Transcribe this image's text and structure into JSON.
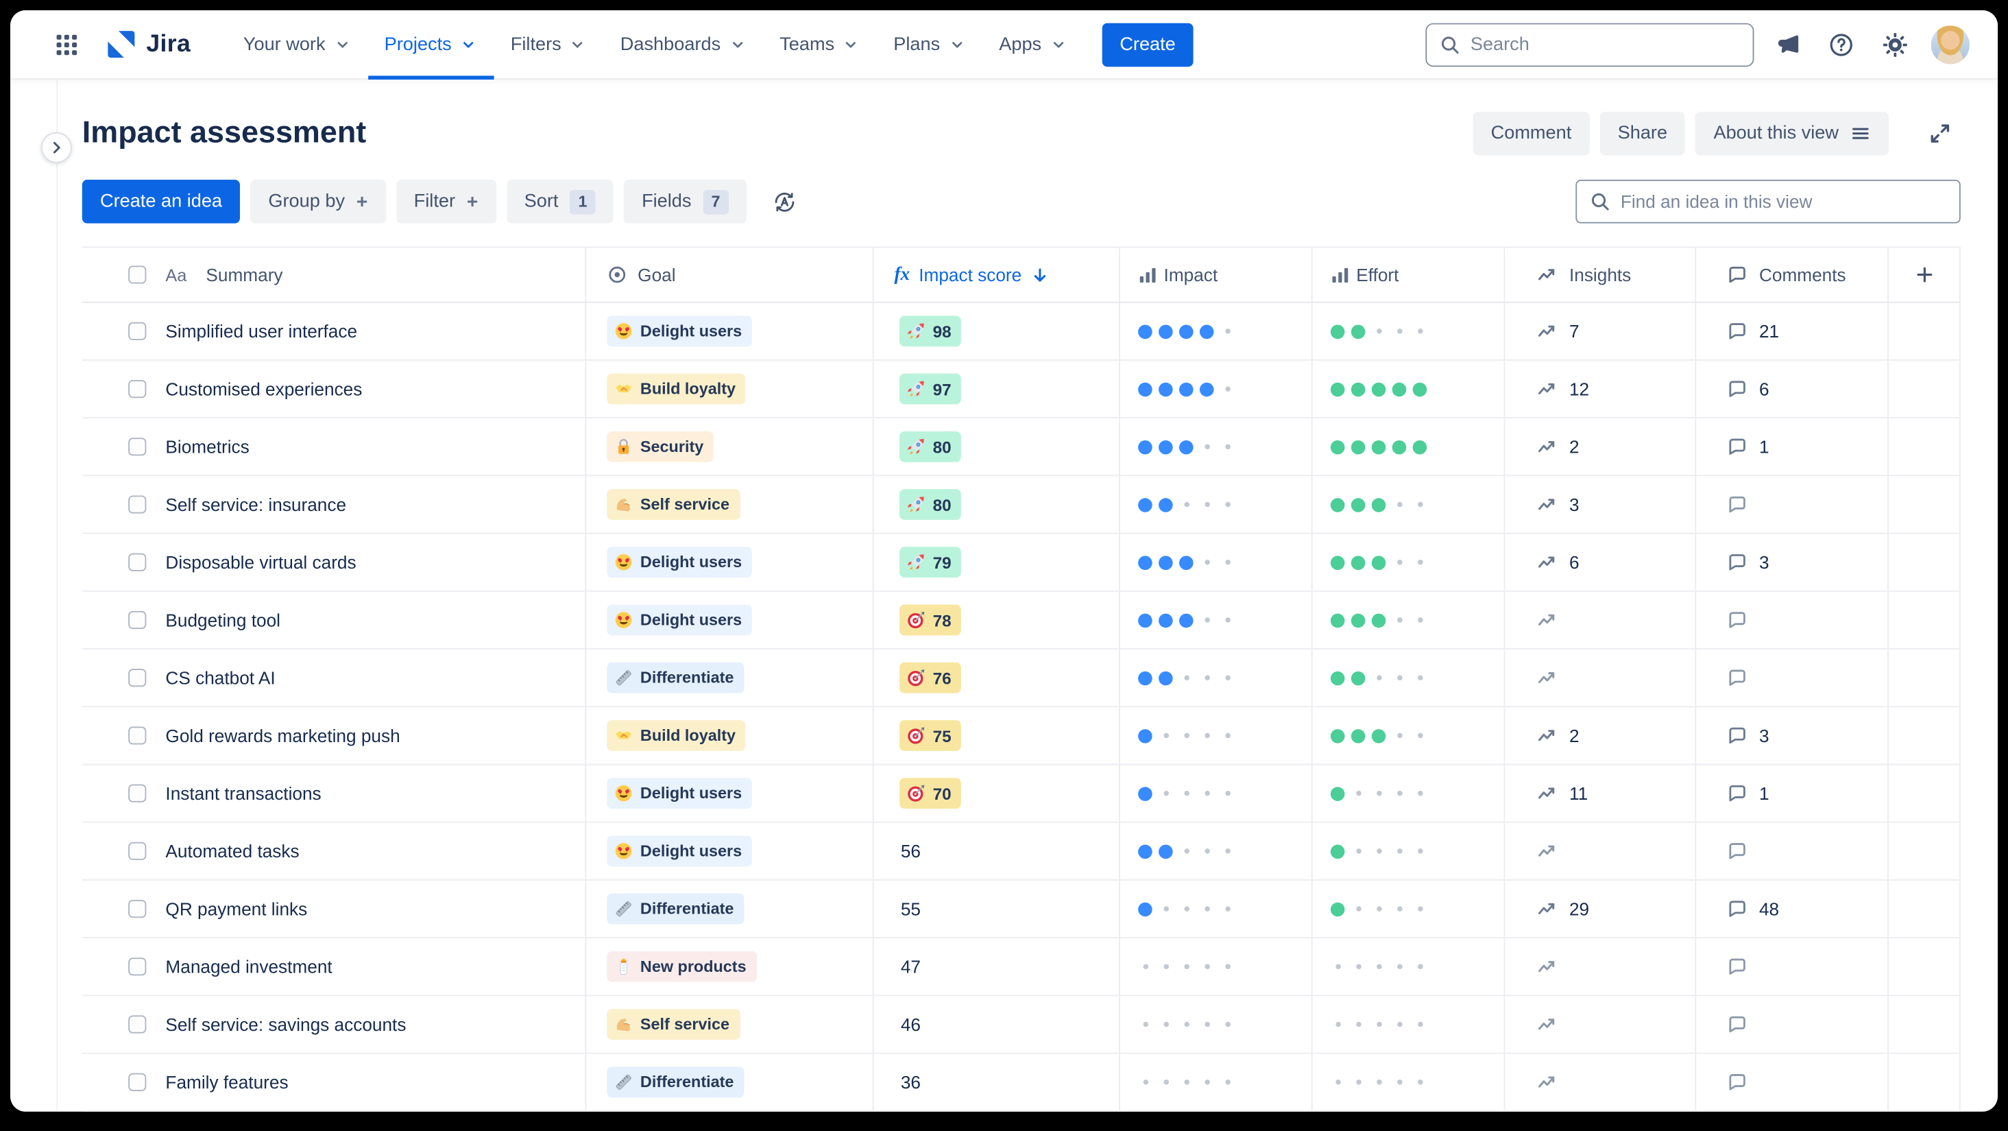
{
  "nav": {
    "app_name": "Jira",
    "items": [
      "Your work",
      "Projects",
      "Filters",
      "Dashboards",
      "Teams",
      "Plans",
      "Apps"
    ],
    "active_item": "Projects",
    "create_label": "Create",
    "search_placeholder": "Search"
  },
  "header": {
    "title": "Impact assessment",
    "comment_label": "Comment",
    "share_label": "Share",
    "about_label": "About this view"
  },
  "toolbar": {
    "create_idea_label": "Create an idea",
    "group_by_label": "Group by",
    "filter_label": "Filter",
    "sort_label": "Sort",
    "sort_count": "1",
    "fields_label": "Fields",
    "fields_count": "7",
    "find_placeholder": "Find an idea in this view"
  },
  "colors": {
    "accent_blue": "#0C66E4",
    "text_dark": "#172B4D",
    "text_subtle": "#44546F",
    "border": "#EBECF0"
  },
  "table": {
    "columns": [
      {
        "key": "summary",
        "label": "Summary",
        "icon": "text-style-icon"
      },
      {
        "key": "goal",
        "label": "Goal",
        "icon": "goal-icon"
      },
      {
        "key": "score",
        "label": "Impact score",
        "icon": "fx-icon",
        "sorted": "desc",
        "color": "#0C66E4"
      },
      {
        "key": "impact",
        "label": "Impact",
        "icon": "bar-chart-icon"
      },
      {
        "key": "effort",
        "label": "Effort",
        "icon": "bar-chart-icon"
      },
      {
        "key": "insights",
        "label": "Insights",
        "icon": "trend-icon"
      },
      {
        "key": "comments",
        "label": "Comments",
        "icon": "comment-icon"
      },
      {
        "key": "add",
        "label": "",
        "icon": "plus-icon"
      }
    ],
    "goal_styles": {
      "Delight users": {
        "icon": "heart-eyes-emoji",
        "bg": "#E9F2FF"
      },
      "Build loyalty": {
        "icon": "handshake-emoji",
        "bg": "#FBF0CA"
      },
      "Security": {
        "icon": "locked-with-key-emoji",
        "bg": "#FDEFDC"
      },
      "Self service": {
        "icon": "flexed-biceps-emoji",
        "bg": "#FBF0CA"
      },
      "Differentiate": {
        "icon": "ruler-emoji",
        "bg": "#E4F0FC"
      },
      "New products": {
        "icon": "baby-bottle-emoji",
        "bg": "#FBECEC"
      }
    },
    "score_styles": {
      "green": {
        "icon": "rocket-emoji",
        "bg": "#BAF3DB"
      },
      "yellow": {
        "icon": "dart-emoji",
        "bg": "#F8E6A0"
      }
    },
    "dot_colors": {
      "impact": "#388BFF",
      "effort": "#4BCE97",
      "empty": "#C2C8D1"
    },
    "dots_max": 5,
    "rows": [
      {
        "summary": "Simplified user interface",
        "goal": "Delight users",
        "score": 98,
        "score_style": "green",
        "impact": 4,
        "effort": 2,
        "insights": 7,
        "comments": 21
      },
      {
        "summary": "Customised experiences",
        "goal": "Build loyalty",
        "score": 97,
        "score_style": "green",
        "impact": 4,
        "effort": 5,
        "insights": 12,
        "comments": 6
      },
      {
        "summary": "Biometrics",
        "goal": "Security",
        "score": 80,
        "score_style": "green",
        "impact": 3,
        "effort": 5,
        "insights": 2,
        "comments": 1
      },
      {
        "summary": "Self service: insurance",
        "goal": "Self service",
        "score": 80,
        "score_style": "green",
        "impact": 2,
        "effort": 3,
        "insights": 3,
        "comments": null
      },
      {
        "summary": "Disposable virtual cards",
        "goal": "Delight users",
        "score": 79,
        "score_style": "green",
        "impact": 3,
        "effort": 3,
        "insights": 6,
        "comments": 3
      },
      {
        "summary": "Budgeting tool",
        "goal": "Delight users",
        "score": 78,
        "score_style": "yellow",
        "impact": 3,
        "effort": 3,
        "insights": null,
        "comments": null
      },
      {
        "summary": "CS chatbot AI",
        "goal": "Differentiate",
        "score": 76,
        "score_style": "yellow",
        "impact": 2,
        "effort": 2,
        "insights": null,
        "comments": null
      },
      {
        "summary": "Gold rewards marketing push",
        "goal": "Build loyalty",
        "score": 75,
        "score_style": "yellow",
        "impact": 1,
        "effort": 3,
        "insights": 2,
        "comments": 3
      },
      {
        "summary": "Instant transactions",
        "goal": "Delight users",
        "score": 70,
        "score_style": "yellow",
        "impact": 1,
        "effort": 1,
        "insights": 11,
        "comments": 1
      },
      {
        "summary": "Automated tasks",
        "goal": "Delight users",
        "score": 56,
        "score_style": "none",
        "impact": 2,
        "effort": 1,
        "insights": null,
        "comments": null
      },
      {
        "summary": "QR payment links",
        "goal": "Differentiate",
        "score": 55,
        "score_style": "none",
        "impact": 1,
        "effort": 1,
        "insights": 29,
        "comments": 48
      },
      {
        "summary": "Managed investment",
        "goal": "New products",
        "score": 47,
        "score_style": "none",
        "impact": 0,
        "effort": 0,
        "insights": null,
        "comments": null
      },
      {
        "summary": "Self service: savings accounts",
        "goal": "Self service",
        "score": 46,
        "score_style": "none",
        "impact": 0,
        "effort": 0,
        "insights": null,
        "comments": null
      },
      {
        "summary": "Family features",
        "goal": "Differentiate",
        "score": 36,
        "score_style": "none",
        "impact": 0,
        "effort": 0,
        "insights": null,
        "comments": null
      }
    ]
  }
}
